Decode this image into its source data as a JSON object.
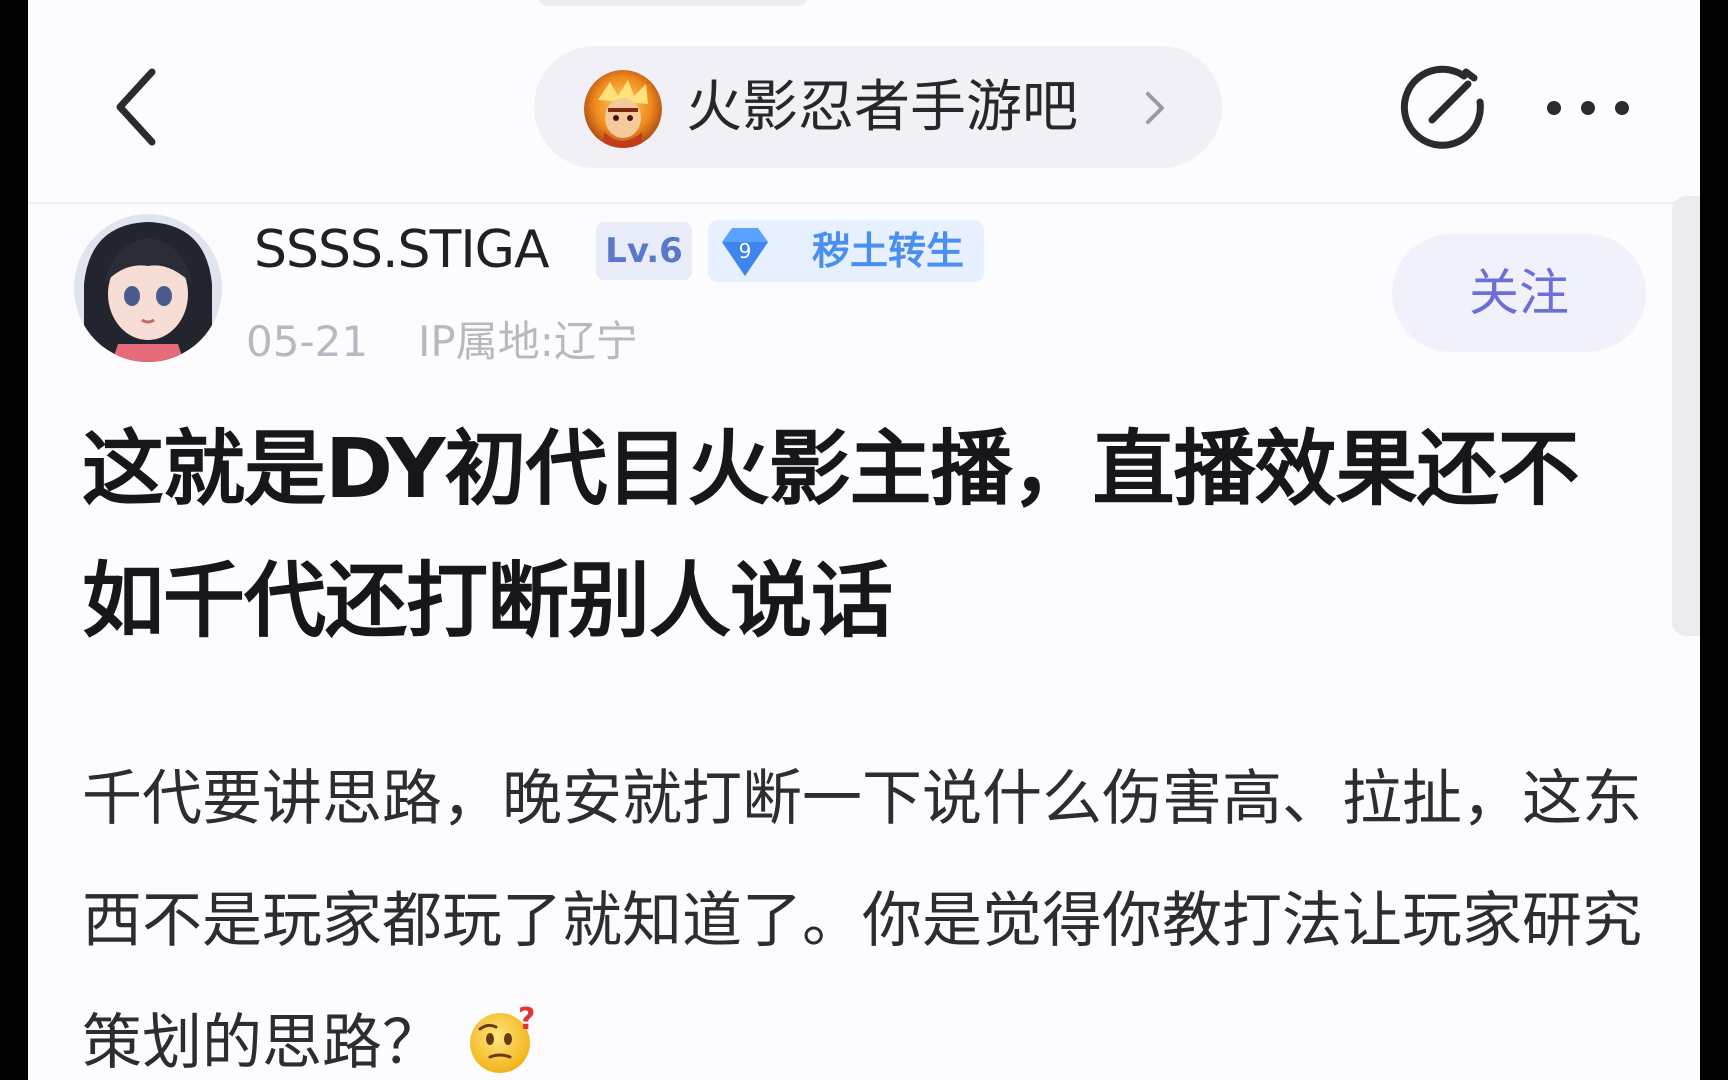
{
  "header": {
    "back_icon": "chevron-left-icon",
    "forum": {
      "name": "火影忍者手游吧",
      "avatar_icon": "forum-avatar-naruto",
      "chevron_icon": "chevron-right-icon"
    },
    "edit_icon": "edit-icon",
    "more_icon": "more-dots-icon"
  },
  "author": {
    "name": "SSSS.STIGA",
    "level": "Lv.6",
    "honor": {
      "level_num": "9",
      "label": "秽土转生"
    },
    "date": "05-21",
    "ip": "IP属地:辽宁",
    "follow_label": "关注"
  },
  "post": {
    "title": "这就是DY初代目火影主播，直播效果还不如千代还打断别人说话",
    "body": "千代要讲思路，晚安就打断一下说什么伤害高、拉扯，这东西不是玩家都玩了就知道了。你是觉得你教打法让玩家研究策划的思路？",
    "emoji_icon": "thinking-face-icon"
  },
  "colors": {
    "accent": "#6c6fd7",
    "level_badge": "#5b77c9",
    "honor_badge": "#4a8ef0",
    "meta_text": "#b8b8c2"
  }
}
